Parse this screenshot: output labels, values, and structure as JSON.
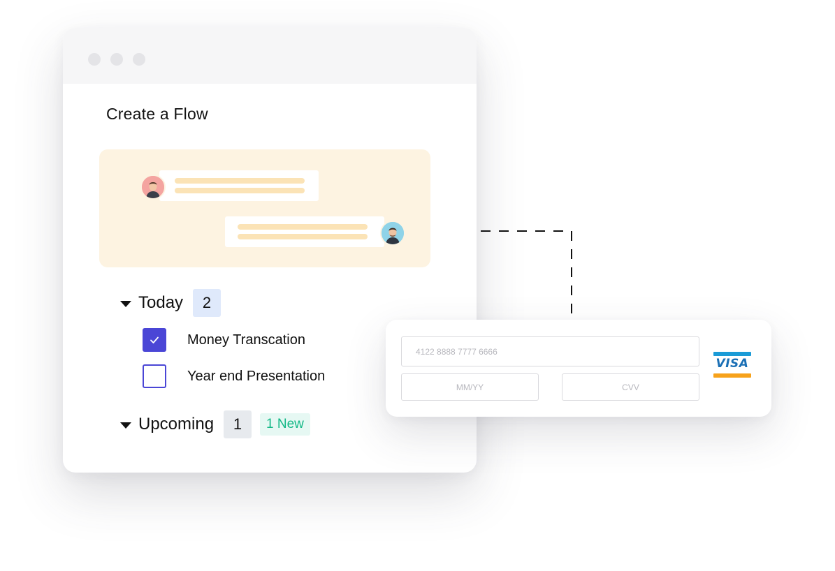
{
  "window": {
    "title": "Create a Flow"
  },
  "sections": {
    "today": {
      "label": "Today",
      "count": "2",
      "tasks": [
        {
          "label": "Money Transcation",
          "checked": true
        },
        {
          "label": "Year end Presentation",
          "checked": false
        }
      ]
    },
    "upcoming": {
      "label": "Upcoming",
      "count": "1",
      "new_badge": "1 New"
    }
  },
  "payment": {
    "card_number_placeholder": "4122 8888 7777 6666",
    "expiry_placeholder": "MM/YY",
    "cvv_placeholder": "CVV",
    "card_brand": "VISA"
  },
  "icons": {
    "caret": "caret-down-icon",
    "check": "check-icon",
    "card_brand": "visa-logo"
  },
  "colors": {
    "accent": "#4a46d6",
    "chat_panel": "#fdf3e1",
    "new_badge_text": "#12b886",
    "today_badge_bg": "#dfe9fb"
  }
}
